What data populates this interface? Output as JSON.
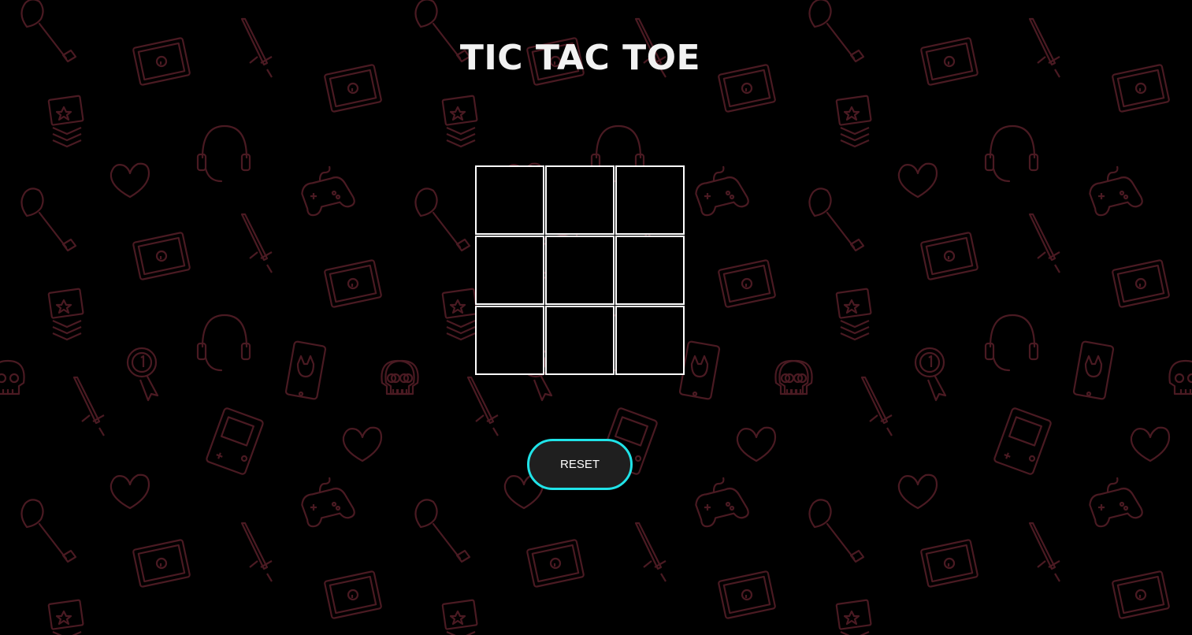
{
  "title": "TIC TAC TOE",
  "board": {
    "cells": [
      "",
      "",
      "",
      "",
      "",
      "",
      "",
      "",
      ""
    ]
  },
  "reset_label": "RESET",
  "colors": {
    "background": "#000000",
    "pattern": "#4a1a22",
    "title": "#f2f2f2",
    "grid": "#ffffff",
    "button_border": "#20e3e8",
    "button_bg": "#1f1f1f"
  },
  "background_icons": [
    "axe-icon",
    "chest-icon",
    "sword-icon",
    "rank-badge-icon",
    "headset-icon",
    "medal-icon",
    "heart-icon",
    "gamepad-icon",
    "skull-icon",
    "tablet-icon",
    "gameboy-icon"
  ]
}
